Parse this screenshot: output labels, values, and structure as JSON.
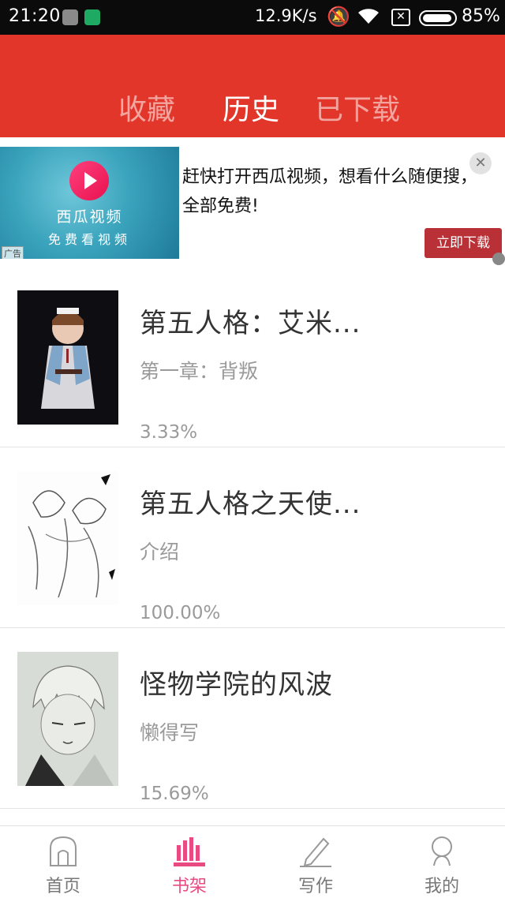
{
  "status_bar": {
    "time": "21:20",
    "net_speed": "12.9K/s",
    "sim_label": "✕",
    "battery": "85%"
  },
  "header": {
    "tabs": [
      {
        "label": "收藏",
        "active": false
      },
      {
        "label": "历史",
        "active": true
      },
      {
        "label": "已下载",
        "active": false
      }
    ],
    "accent_color": "#e3362b"
  },
  "ad": {
    "brand": "西瓜视频",
    "slogan": "免费看视频",
    "tag": "广告",
    "text": "赶快打开西瓜视频，想看什么随便搜，全部免费!",
    "close": "✕",
    "button": "立即下载"
  },
  "books": [
    {
      "title": "第五人格：艾米...",
      "chapter": "第一章：背叛",
      "progress": "3.33%"
    },
    {
      "title": "第五人格之天使...",
      "chapter": "介绍",
      "progress": "100.00%"
    },
    {
      "title": "怪物学院的风波",
      "chapter": "懒得写",
      "progress": "15.69%"
    }
  ],
  "bottom_nav": [
    {
      "label": "首页",
      "icon": "home-icon",
      "active": false
    },
    {
      "label": "书架",
      "icon": "bookshelf-icon",
      "active": true
    },
    {
      "label": "写作",
      "icon": "pen-icon",
      "active": false
    },
    {
      "label": "我的",
      "icon": "profile-icon",
      "active": false
    }
  ],
  "nav_active_color": "#e94a82"
}
